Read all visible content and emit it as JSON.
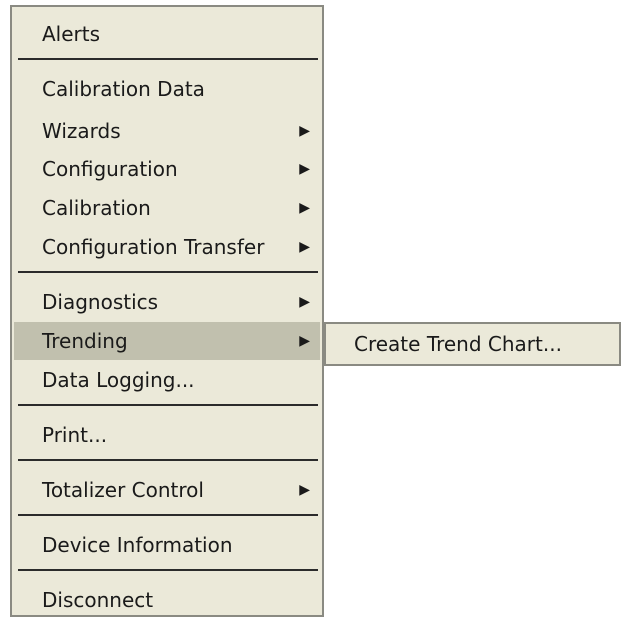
{
  "menu": {
    "items": [
      {
        "label": "Alerts"
      },
      {
        "label": "Calibration Data"
      },
      {
        "label": "Wizards",
        "arrow": "▶"
      },
      {
        "label": "Configuration",
        "arrow": "▶"
      },
      {
        "label": "Calibration",
        "arrow": "▶"
      },
      {
        "label": "Configuration Transfer",
        "arrow": "▶"
      },
      {
        "label": "Diagnostics",
        "arrow": "▶"
      },
      {
        "label": "Trending",
        "arrow": "▶"
      },
      {
        "label": "Data Logging..."
      },
      {
        "label": "Print..."
      },
      {
        "label": "Totalizer Control",
        "arrow": "▶"
      },
      {
        "label": "Device Information"
      },
      {
        "label": "Disconnect"
      }
    ],
    "highlighted": "Trending",
    "icons": {
      "submenu_arrow": "chevron-right-icon"
    }
  },
  "submenu": {
    "items": [
      {
        "label": "Create Trend Chart..."
      }
    ]
  },
  "colors": {
    "menu_background": "#ebe9d9",
    "highlight": "#c1c0ae",
    "border": "#8a8a82",
    "separator": "#2b2b2b"
  }
}
